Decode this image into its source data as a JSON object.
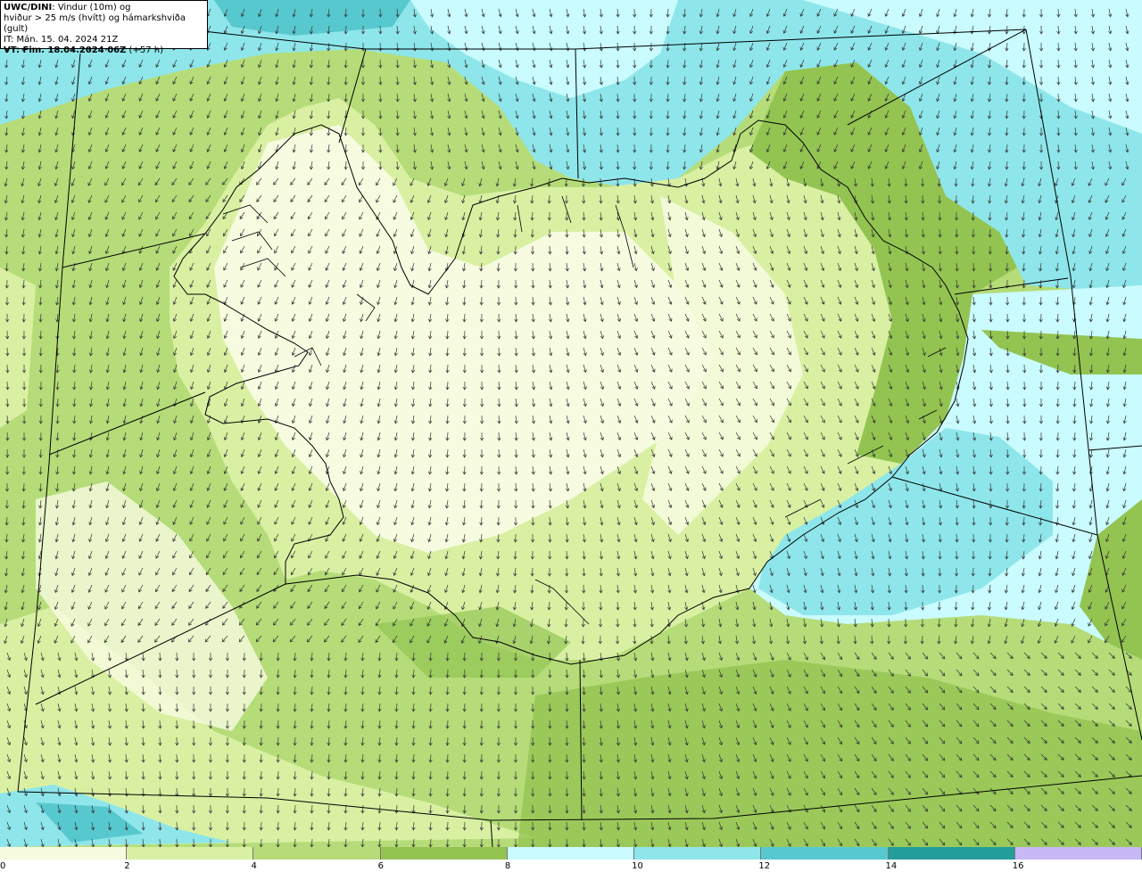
{
  "title": {
    "model": "UWC/DINI",
    "line1_rest": ": Vindur (10m) og",
    "line2": "hviður > 25 m/s (hvítt) og hámarkshviða (gult)",
    "line3": "IT: Mán. 15. 04. 2024 21Z",
    "line4_bold": "VT: Fim. 18.04.2024 06Z",
    "line4_rest": " (+57 h)"
  },
  "colorbar": {
    "colors": [
      "#f7fbe0",
      "#d9f0a3",
      "#b5dc78",
      "#93c452",
      "#c9fbff",
      "#8ee6ea",
      "#58c8cf",
      "#239d9a",
      "#c8b8f5"
    ],
    "ticks": [
      "0",
      "2",
      "4",
      "6",
      "8",
      "10",
      "12",
      "14",
      "16"
    ]
  },
  "map": {
    "wind_arrow_color": "#333333",
    "coastline_color": "#000000",
    "boundary_line_color": "#000000"
  }
}
